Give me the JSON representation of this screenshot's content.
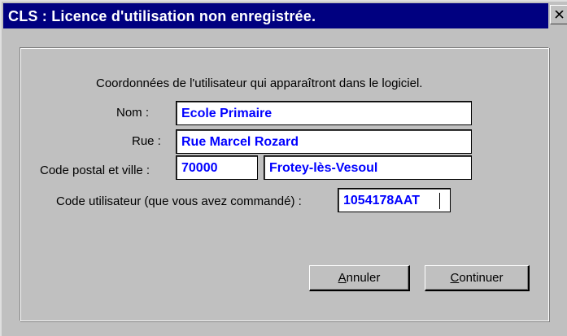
{
  "window": {
    "title": "CLS : Licence d'utilisation non enregistrée."
  },
  "form": {
    "intro": "Coordonnées de l'utilisateur qui apparaîtront dans le logiciel.",
    "nom_label": "Nom :",
    "nom_value": "Ecole Primaire",
    "rue_label": "Rue :",
    "rue_value": "Rue Marcel Rozard",
    "cp_ville_label": "Code postal et ville :",
    "code_postal_value": "70000",
    "ville_value": "Frotey-lès-Vesoul",
    "code_utilisateur_label": "Code utilisateur (que vous avez commandé) :",
    "code_utilisateur_value": "1054178AAT"
  },
  "buttons": {
    "annuler_mnemonic": "A",
    "annuler_rest": "nnuler",
    "continuer_mnemonic": "C",
    "continuer_rest": "ontinuer"
  },
  "colors": {
    "titlebar": "#000080",
    "field_text": "#0000ff",
    "face": "#c0c0c0"
  },
  "icons": {
    "close": "close-icon"
  }
}
